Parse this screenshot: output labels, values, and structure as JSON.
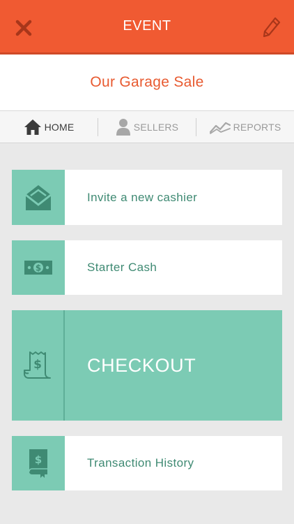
{
  "header": {
    "title": "EVENT",
    "close_icon": "close-icon",
    "edit_icon": "pencil-icon"
  },
  "event": {
    "name": "Our Garage Sale"
  },
  "tabs": [
    {
      "label": "HOME",
      "icon": "home-icon",
      "active": true
    },
    {
      "label": "SELLERS",
      "icon": "person-icon",
      "active": false
    },
    {
      "label": "REPORTS",
      "icon": "chart-line-icon",
      "active": false
    }
  ],
  "menu": {
    "invite": {
      "label": "Invite a new cashier",
      "icon": "envelope-icon"
    },
    "starter_cash": {
      "label": "Starter Cash",
      "icon": "dollar-bill-icon"
    },
    "checkout": {
      "label": "CHECKOUT",
      "icon": "receipt-icon"
    },
    "history": {
      "label": "Transaction History",
      "icon": "ledger-book-icon"
    }
  },
  "colors": {
    "header_bg": "#f05a32",
    "accent_teal": "#7ccbb4",
    "teal_text": "#3f8a73",
    "event_name": "#e85a30",
    "background": "#e9e9e9"
  }
}
